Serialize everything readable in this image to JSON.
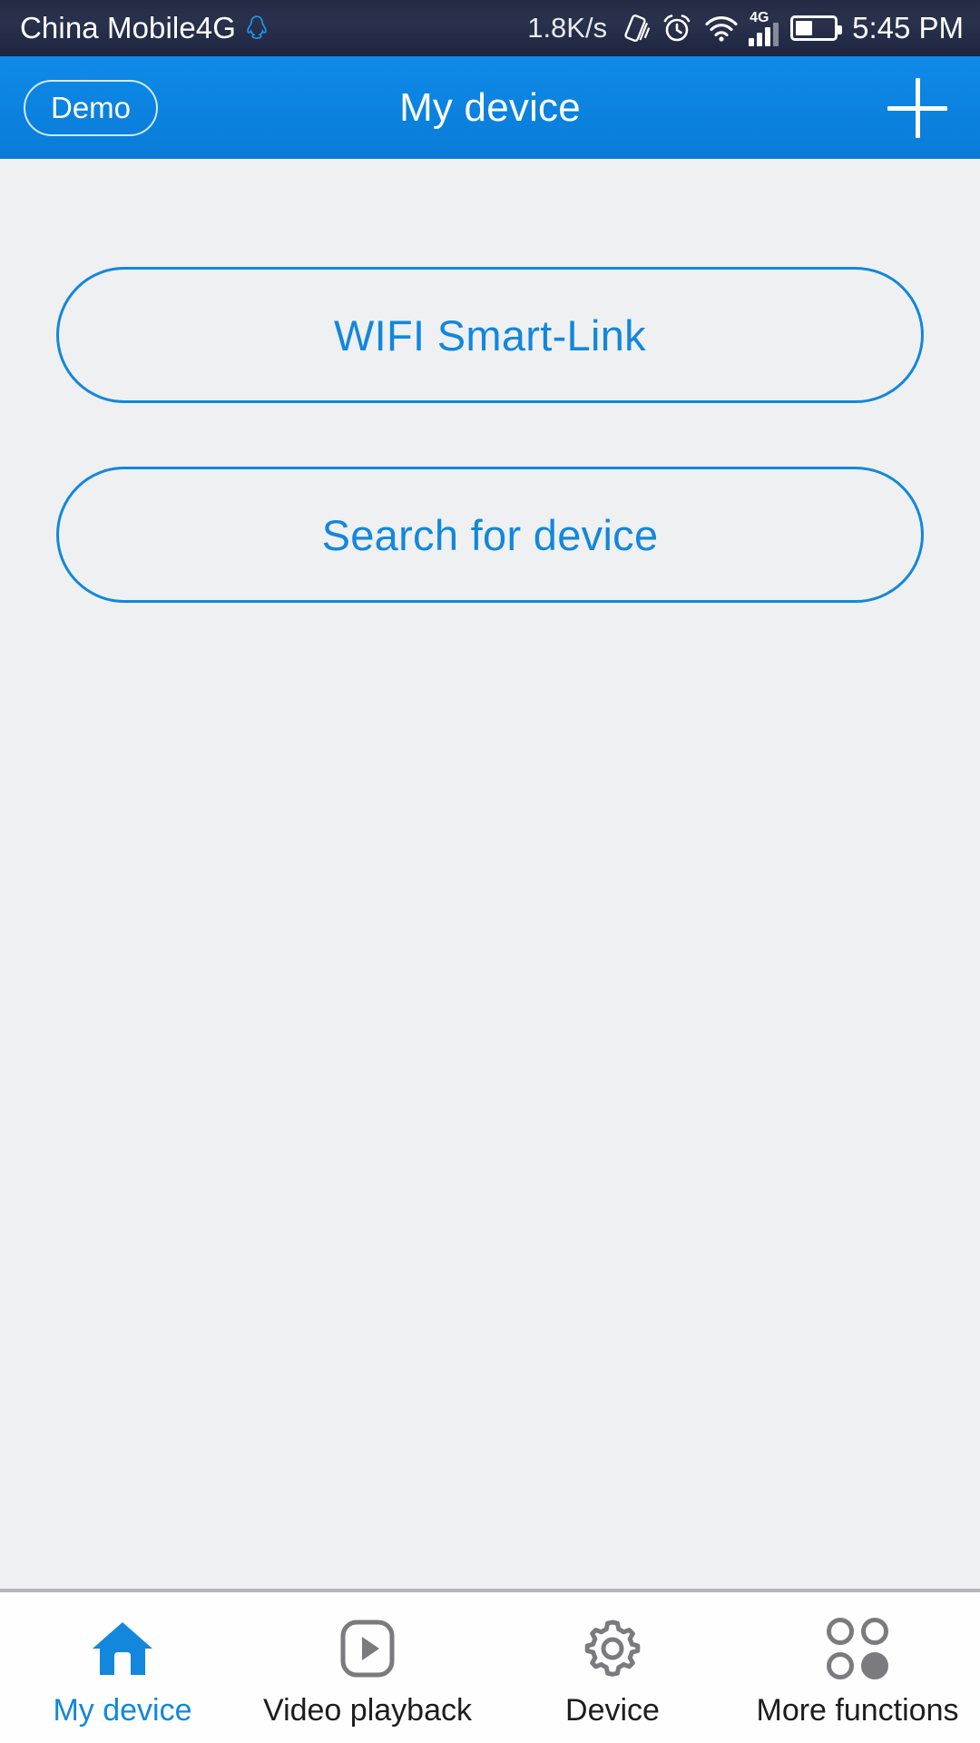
{
  "status_bar": {
    "carrier": "China Mobile4G",
    "qq_icon": "qq-penguin-icon",
    "network_speed": "1.8K/s",
    "vibrate_icon": "vibrate-icon",
    "alarm_icon": "alarm-clock-icon",
    "wifi_icon": "wifi-icon",
    "network_type": "4G",
    "signal_icon": "signal-bars-icon",
    "battery_icon": "battery-icon",
    "battery_level_percent": 40,
    "signal_bars_filled": 3,
    "signal_bars_total": 4,
    "time": "5:45 PM",
    "background_color": "#232b45",
    "text_color": "#ffffff"
  },
  "header": {
    "demo_label": "Demo",
    "title": "My device",
    "add_icon": "plus-icon",
    "background_color": "#0b82df",
    "text_color": "#ffffff"
  },
  "content": {
    "background_color": "#eff0f1",
    "accent_color": "#1287dc",
    "buttons": [
      {
        "label": "WIFI Smart-Link",
        "name": "wifi-smart-link-button"
      },
      {
        "label": "Search for device",
        "name": "search-for-device-button"
      }
    ]
  },
  "tab_bar": {
    "active_color": "#1287dc",
    "inactive_color": "#1d1d1d",
    "icon_color": "#7b7b7f",
    "background_color": "#fefefe",
    "tabs": [
      {
        "label": "My device",
        "icon": "home-icon",
        "active": true
      },
      {
        "label": "Video playback",
        "icon": "play-video-icon",
        "active": false
      },
      {
        "label": "Device",
        "icon": "gear-icon",
        "active": false
      },
      {
        "label": "More functions",
        "icon": "four-dots-icon",
        "active": false
      }
    ]
  }
}
